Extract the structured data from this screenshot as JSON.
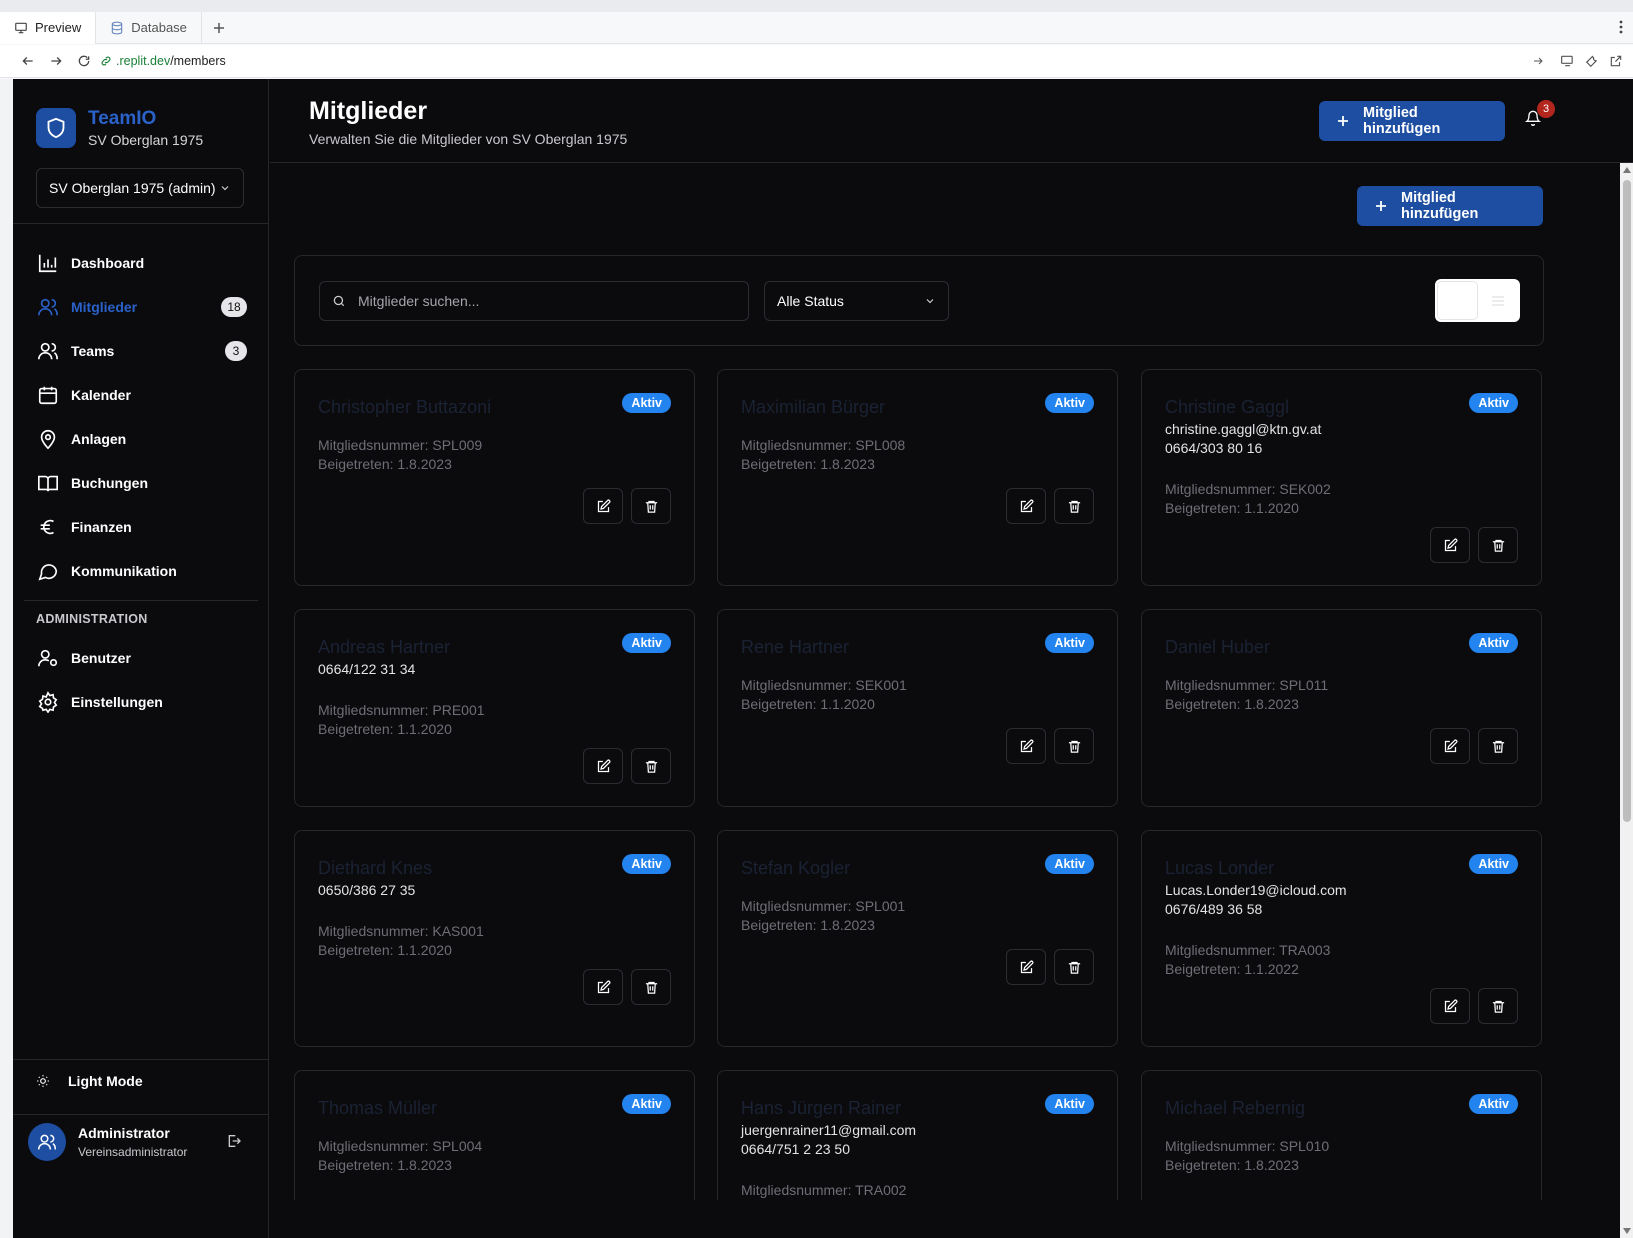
{
  "browser": {
    "tabs": [
      {
        "label": "Preview",
        "icon": "monitor-icon"
      },
      {
        "label": "Database",
        "icon": "database-icon"
      }
    ],
    "url_domain": ".replit.dev",
    "url_path": "/members"
  },
  "sidebar": {
    "brand_name": "TeamIO",
    "brand_sub": "SV Oberglan 1975",
    "club_select": "SV Oberglan 1975 (admin)",
    "items": [
      {
        "label": "Dashboard",
        "icon": "bar-chart-icon",
        "active": false
      },
      {
        "label": "Mitglieder",
        "icon": "users-icon",
        "active": true,
        "badge": "18"
      },
      {
        "label": "Teams",
        "icon": "user-group-icon",
        "active": false,
        "badge": "3"
      },
      {
        "label": "Kalender",
        "icon": "calendar-icon",
        "active": false
      },
      {
        "label": "Anlagen",
        "icon": "map-pin-icon",
        "active": false
      },
      {
        "label": "Buchungen",
        "icon": "book-icon",
        "active": false
      },
      {
        "label": "Finanzen",
        "icon": "euro-icon",
        "active": false
      },
      {
        "label": "Kommunikation",
        "icon": "message-icon",
        "active": false
      }
    ],
    "admin_label": "ADMINISTRATION",
    "admin_items": [
      {
        "label": "Benutzer",
        "icon": "user-cog-icon"
      },
      {
        "label": "Einstellungen",
        "icon": "gear-icon"
      }
    ],
    "light_mode": "Light Mode",
    "user_name": "Administrator",
    "user_role": "Vereinsadministrator"
  },
  "header": {
    "title": "Mitglieder",
    "subtitle": "Verwalten Sie die Mitglieder von SV Oberglan 1975",
    "add_button": "Mitglied hinzufügen",
    "notification_count": "3"
  },
  "content": {
    "add_button": "Mitglied hinzufügen",
    "search_placeholder": "Mitglieder suchen...",
    "status_filter": "Alle Status"
  },
  "members": [
    {
      "name": "Christopher Buttazoni",
      "status": "Aktiv",
      "contact": [],
      "number": "Mitgliedsnummer: SPL009",
      "joined": "Beigetreten: 1.8.2023"
    },
    {
      "name": "Maximilian Bürger",
      "status": "Aktiv",
      "contact": [],
      "number": "Mitgliedsnummer: SPL008",
      "joined": "Beigetreten: 1.8.2023"
    },
    {
      "name": "Christine Gaggl",
      "status": "Aktiv",
      "contact": [
        "christine.gaggl@ktn.gv.at",
        "0664/303 80 16"
      ],
      "number": "Mitgliedsnummer: SEK002",
      "joined": "Beigetreten: 1.1.2020"
    },
    {
      "name": "Andreas Hartner",
      "status": "Aktiv",
      "contact": [
        "0664/122 31 34"
      ],
      "number": "Mitgliedsnummer: PRE001",
      "joined": "Beigetreten: 1.1.2020"
    },
    {
      "name": "Rene Hartner",
      "status": "Aktiv",
      "contact": [],
      "number": "Mitgliedsnummer: SEK001",
      "joined": "Beigetreten: 1.1.2020"
    },
    {
      "name": "Daniel Huber",
      "status": "Aktiv",
      "contact": [],
      "number": "Mitgliedsnummer: SPL011",
      "joined": "Beigetreten: 1.8.2023"
    },
    {
      "name": "Diethard Knes",
      "status": "Aktiv",
      "contact": [
        "0650/386 27 35"
      ],
      "number": "Mitgliedsnummer: KAS001",
      "joined": "Beigetreten: 1.1.2020"
    },
    {
      "name": "Stefan Kogler",
      "status": "Aktiv",
      "contact": [],
      "number": "Mitgliedsnummer: SPL001",
      "joined": "Beigetreten: 1.8.2023"
    },
    {
      "name": "Lucas Londer",
      "status": "Aktiv",
      "contact": [
        "Lucas.Londer19@icloud.com",
        "0676/489 36 58"
      ],
      "number": "Mitgliedsnummer: TRA003",
      "joined": "Beigetreten: 1.1.2022"
    },
    {
      "name": "Thomas Müller",
      "status": "Aktiv",
      "contact": [],
      "number": "Mitgliedsnummer: SPL004",
      "joined": "Beigetreten: 1.8.2023"
    },
    {
      "name": "Hans Jürgen Rainer",
      "status": "Aktiv",
      "contact": [
        "juergenrainer11@gmail.com",
        "0664/751 2 23 50"
      ],
      "number": "Mitgliedsnummer: TRA002",
      "joined": ""
    },
    {
      "name": "Michael Rebernig",
      "status": "Aktiv",
      "contact": [],
      "number": "Mitgliedsnummer: SPL010",
      "joined": "Beigetreten: 1.8.2023"
    }
  ],
  "colors": {
    "accent": "#1d4ea1",
    "accent_text": "#2a62c9",
    "badge": "#2384f0",
    "background": "#0b0b0e",
    "notification": "#b3261e"
  }
}
